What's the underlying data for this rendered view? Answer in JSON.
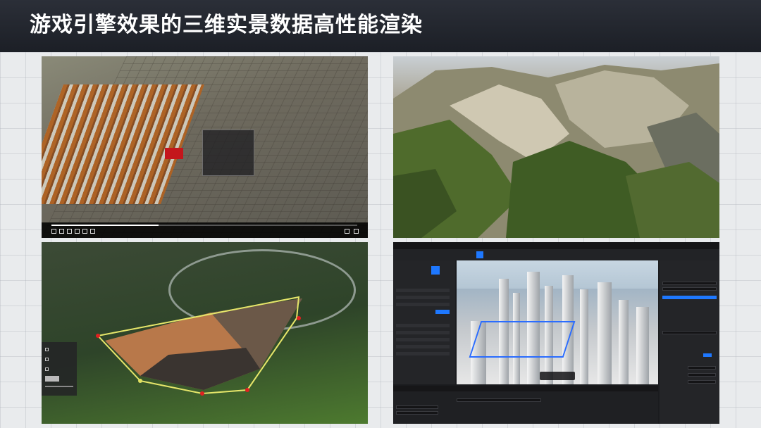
{
  "header": {
    "title": "游戏引擎效果的三维实景数据高性能渲染"
  },
  "panels": [
    {
      "id": "city-palace-view",
      "label": ""
    },
    {
      "id": "mountain-terrain-view",
      "label": ""
    },
    {
      "id": "excavation-pit-view",
      "label": ""
    },
    {
      "id": "editor-city-view",
      "label": ""
    }
  ],
  "colors": {
    "header_bg": "#1c1f26",
    "header_text": "#ffffff",
    "editor_accent": "#1e78ff",
    "pit_outline": "#e6e66a",
    "selection_outline": "#2a6cff",
    "palace_red": "#c4161c"
  },
  "video_player": {
    "progress": 0.35
  }
}
